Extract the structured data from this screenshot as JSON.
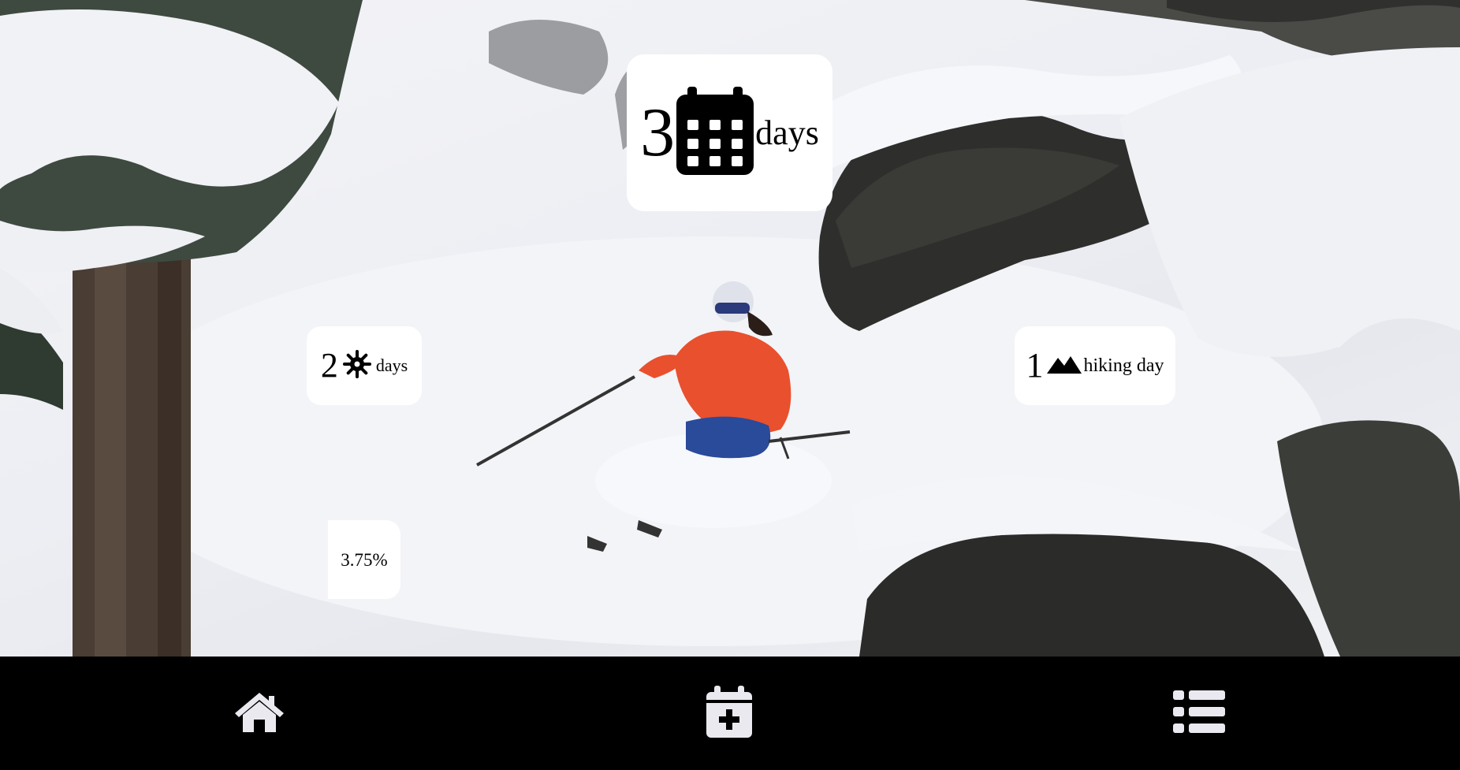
{
  "stats": {
    "total": {
      "value": "3",
      "unit": "days",
      "icon": "calendar-icon"
    },
    "snow": {
      "value": "2",
      "unit": "days",
      "icon": "snowflake-icon"
    },
    "hiking": {
      "value": "1",
      "unit": "hiking day",
      "icon": "mountain-icon"
    },
    "percent": {
      "value": "3.75%"
    }
  },
  "nav": {
    "items": [
      {
        "name": "home",
        "icon": "home-icon"
      },
      {
        "name": "add-day",
        "icon": "calendar-plus-icon"
      },
      {
        "name": "list",
        "icon": "list-icon"
      }
    ],
    "icon_color": "#e9e9ef"
  },
  "background": {
    "description_color": "#ffffff"
  }
}
